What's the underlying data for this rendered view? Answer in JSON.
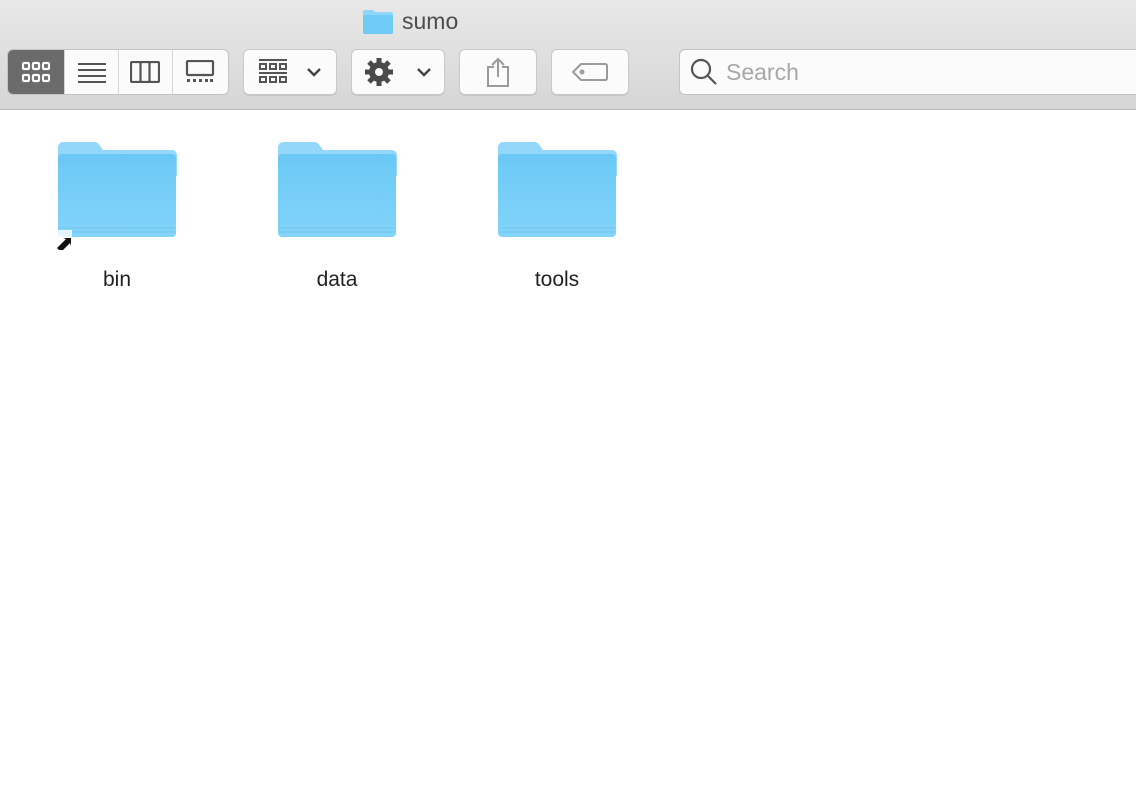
{
  "window": {
    "title": "sumo",
    "title_icon": "folder-icon"
  },
  "toolbar": {
    "view_modes": [
      {
        "name": "icon-view",
        "icon": "grid-icon",
        "active": true
      },
      {
        "name": "list-view",
        "icon": "list-icon",
        "active": false
      },
      {
        "name": "column-view",
        "icon": "columns-icon",
        "active": false
      },
      {
        "name": "gallery-view",
        "icon": "gallery-icon",
        "active": false
      }
    ],
    "group_button": {
      "icon": "group-grid-icon"
    },
    "action_button": {
      "icon": "gear-icon"
    },
    "share_button": {
      "icon": "share-icon"
    },
    "tag_button": {
      "icon": "tag-icon"
    },
    "search": {
      "placeholder": "Search",
      "value": ""
    }
  },
  "items": [
    {
      "name": "bin",
      "alias": true
    },
    {
      "name": "data",
      "alias": false
    },
    {
      "name": "tools",
      "alias": false
    }
  ],
  "colors": {
    "folder": "#6ecbf5",
    "accent_active": "#6b6b6b"
  }
}
